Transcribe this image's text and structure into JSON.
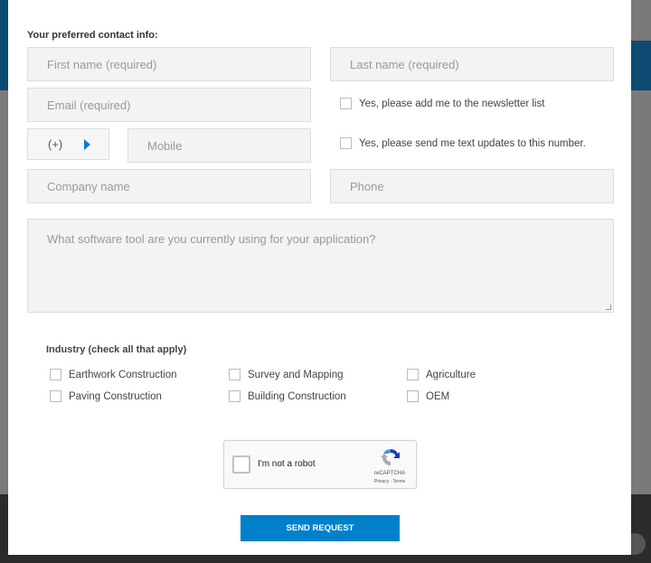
{
  "form": {
    "title": "Your preferred contact info:",
    "first_name_placeholder": "First name (required)",
    "last_name_placeholder": "Last name (required)",
    "email_placeholder": "Email (required)",
    "newsletter_label": "Yes, please add me to the newsletter list",
    "country_code": "(+)",
    "mobile_placeholder": "Mobile",
    "text_updates_label": "Yes, please send me text updates to this number.",
    "company_placeholder": "Company name",
    "phone_placeholder": "Phone",
    "software_placeholder": "What software tool are you currently using for your application?",
    "industry_title": "Industry (check all that apply)",
    "industries": [
      "Earthwork Construction",
      "Survey and Mapping",
      "Agriculture",
      "Paving Construction",
      "Building Construction",
      "OEM"
    ],
    "captcha_label": "I'm not a robot",
    "captcha_brand": "reCAPTCHA",
    "captcha_links": "Privacy - Terms",
    "send_label": "SEND REQUEST"
  },
  "colors": {
    "accent": "#0080c9",
    "backdrop_blue": "#0f4a73"
  }
}
